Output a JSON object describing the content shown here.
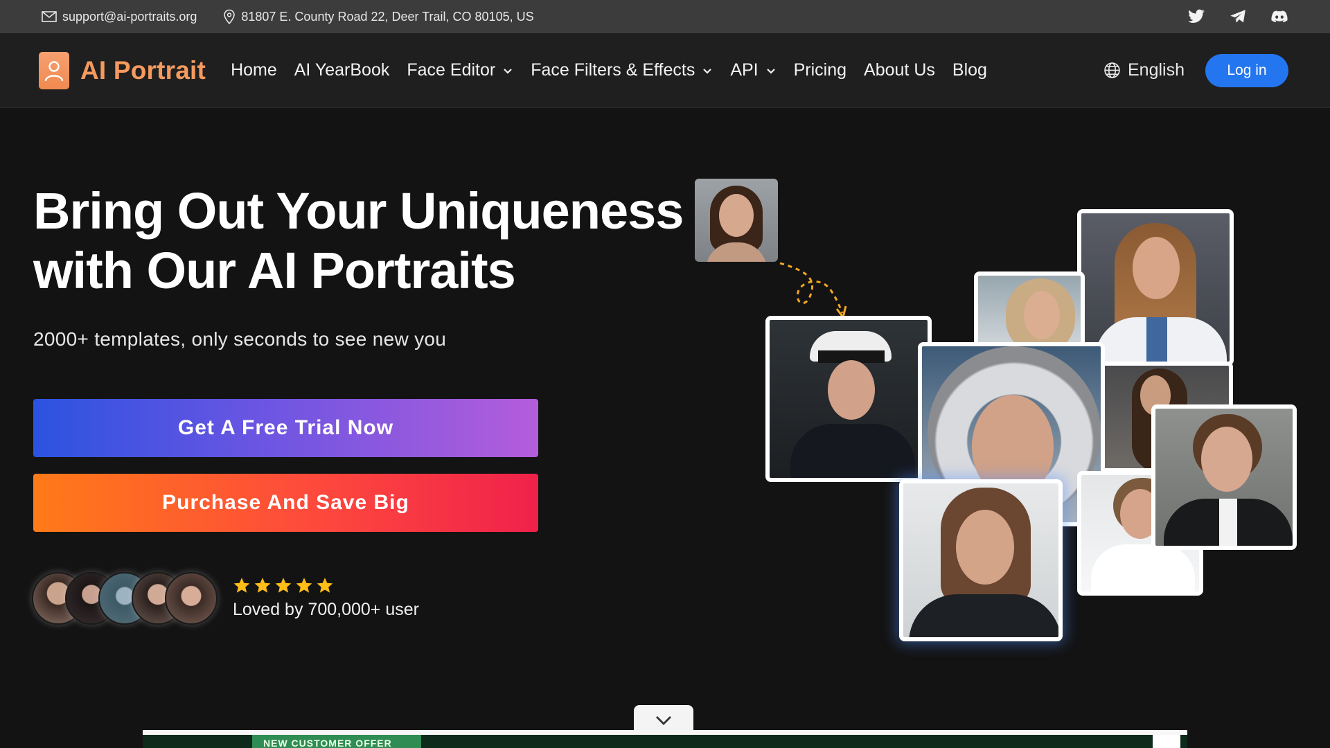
{
  "topbar": {
    "email": "support@ai-portraits.org",
    "address": "81807 E. County Road 22, Deer Trail, CO 80105, US",
    "social": [
      "twitter-icon",
      "telegram-icon",
      "discord-icon"
    ]
  },
  "nav": {
    "brand": "AI Portrait",
    "items": [
      {
        "label": "Home",
        "dropdown": false
      },
      {
        "label": "AI YearBook",
        "dropdown": false
      },
      {
        "label": "Face Editor",
        "dropdown": true
      },
      {
        "label": "Face Filters & Effects",
        "dropdown": true
      },
      {
        "label": "API",
        "dropdown": true
      },
      {
        "label": "Pricing",
        "dropdown": false
      },
      {
        "label": "About Us",
        "dropdown": false
      },
      {
        "label": "Blog",
        "dropdown": false
      }
    ],
    "language": "English",
    "login": "Log in"
  },
  "hero": {
    "title_line1": "Bring Out Your Uniqueness",
    "title_line2": "with Our AI Portraits",
    "subtitle": "2000+ templates, only seconds to see new you",
    "cta_primary": "Get A Free Trial Now",
    "cta_secondary": "Purchase And Save Big",
    "rating_stars": 5,
    "social_proof": "Loved by 700,000+ user"
  },
  "ad": {
    "label": "NEW CUSTOMER OFFER"
  },
  "colors": {
    "brand": "#f59a5f",
    "login": "#2476f0",
    "star": "#ffbd1a"
  }
}
